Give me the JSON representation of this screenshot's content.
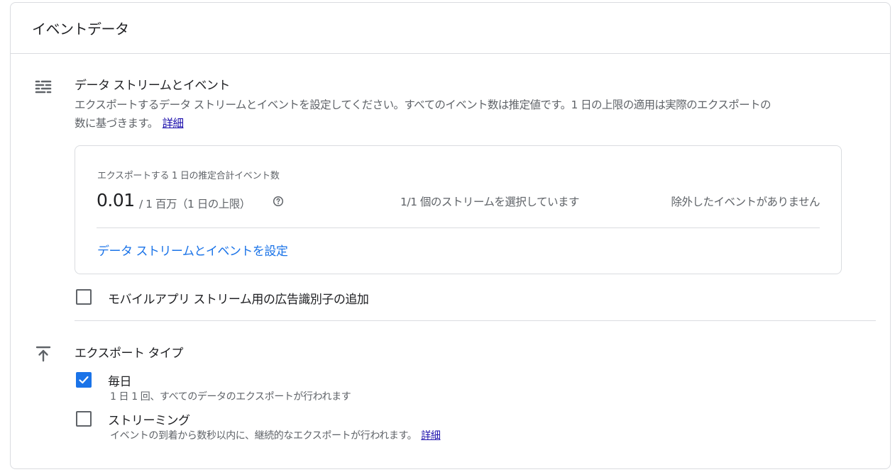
{
  "card": {
    "title": "イベントデータ"
  },
  "streams_section": {
    "icon": "tune-lines-icon",
    "title": "データ ストリームとイベント",
    "description": "エクスポートするデータ ストリームとイベントを設定してください。すべてのイベント数は推定値です。1 日の上限の適用は実際のエクスポートの数に基づきます。",
    "learn_more": "詳細",
    "estimate": {
      "label": "エクスポートする 1 日の推定合計イベント数",
      "value": "0.01",
      "limit": "/ 1 百万（1 日の上限）",
      "help_icon": "help-circle-icon",
      "streams_selected": "1/1 個のストリームを選択しています",
      "excluded_events": "除外したイベントがありません",
      "configure_link": "データ ストリームとイベントを設定"
    },
    "ad_id_checkbox": {
      "label": "モバイルアプリ ストリーム用の広告識別子の追加",
      "checked": false
    }
  },
  "export_type_section": {
    "icon": "upload-arrow-icon",
    "title": "エクスポート タイプ",
    "options": [
      {
        "label": "毎日",
        "sublabel": "1 日 1 回、すべてのデータのエクスポートが行われます",
        "checked": true
      },
      {
        "label": "ストリーミング",
        "sublabel": "イベントの到着から数秒以内に、継続的なエクスポートが行われます。",
        "learn_more": "詳細",
        "checked": false
      }
    ]
  },
  "colors": {
    "accent": "#1a73e8",
    "link_visited": "#1a0dab",
    "border": "#dadce0",
    "text_secondary": "#5f6368"
  }
}
